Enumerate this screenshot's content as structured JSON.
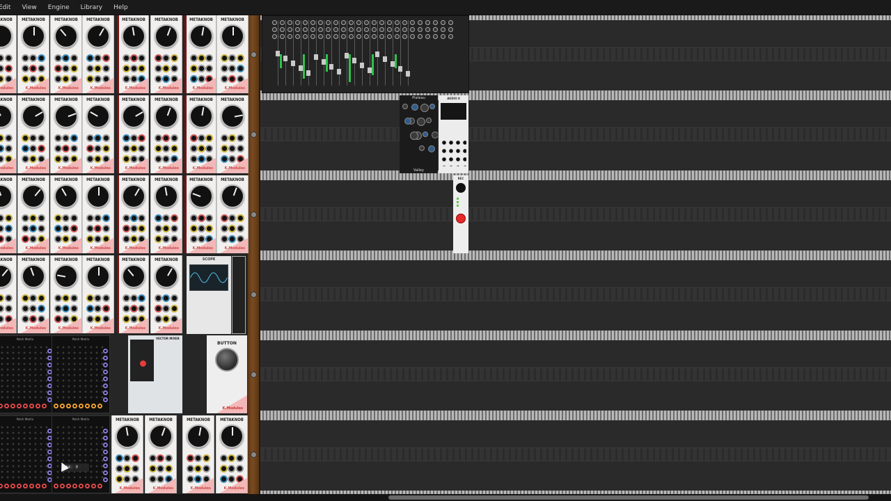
{
  "menu": {
    "items": [
      "Edit",
      "View",
      "Engine",
      "Library",
      "Help"
    ]
  },
  "modules": {
    "metaknob_title": "METAKNOB",
    "metaknob_footer": "K.Modules",
    "scope_title": "SCOPE",
    "button_title": "BUTTON",
    "button_footer": "K.Modules",
    "vector_mixer_title": "VECTOR MIXER",
    "plateau_title": "Plateau",
    "plateau_footer": "Valley",
    "audio_title": "AUDIO 8",
    "rec_title": "REC",
    "patch_matrix_title": "Patch Matrix"
  },
  "tooltip": {
    "text": "#4: 0"
  },
  "scrollbar": {
    "position_fraction": 0.45
  },
  "colors": {
    "background": "#262626",
    "wood": "#7b4b21",
    "menubar": "#1a1a1a",
    "module_panel": "#f1f0ee",
    "accent_pink": "#f2b7b7",
    "jack_red": "#e24a4a",
    "jack_orange": "#f0a232",
    "rec_button": "#e32b2b"
  }
}
